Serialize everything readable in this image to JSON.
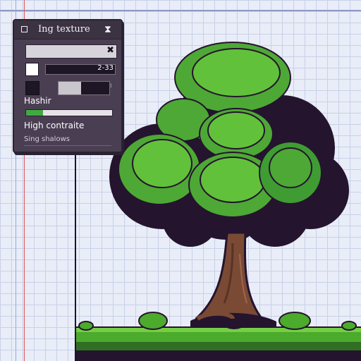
{
  "panel": {
    "title": "Ing texture",
    "number_value": "2-33",
    "slider_level": 0.45,
    "label_hashing": "Hashir",
    "progress_level": 0.2,
    "label_contrast": "High contraite",
    "label_shadows": "Sing shalows"
  },
  "icons": {
    "title_icon": "square-outline-icon",
    "close_icon": "hourglass-close-icon",
    "clear_icon": "x-icon"
  },
  "colors": {
    "panel_bg": "#4a3f52",
    "leaf_light": "#62c13a",
    "leaf_mid": "#3f9c32",
    "leaf_dark": "#24142e",
    "trunk": "#7a4a35",
    "grass": "#4caa2c"
  }
}
